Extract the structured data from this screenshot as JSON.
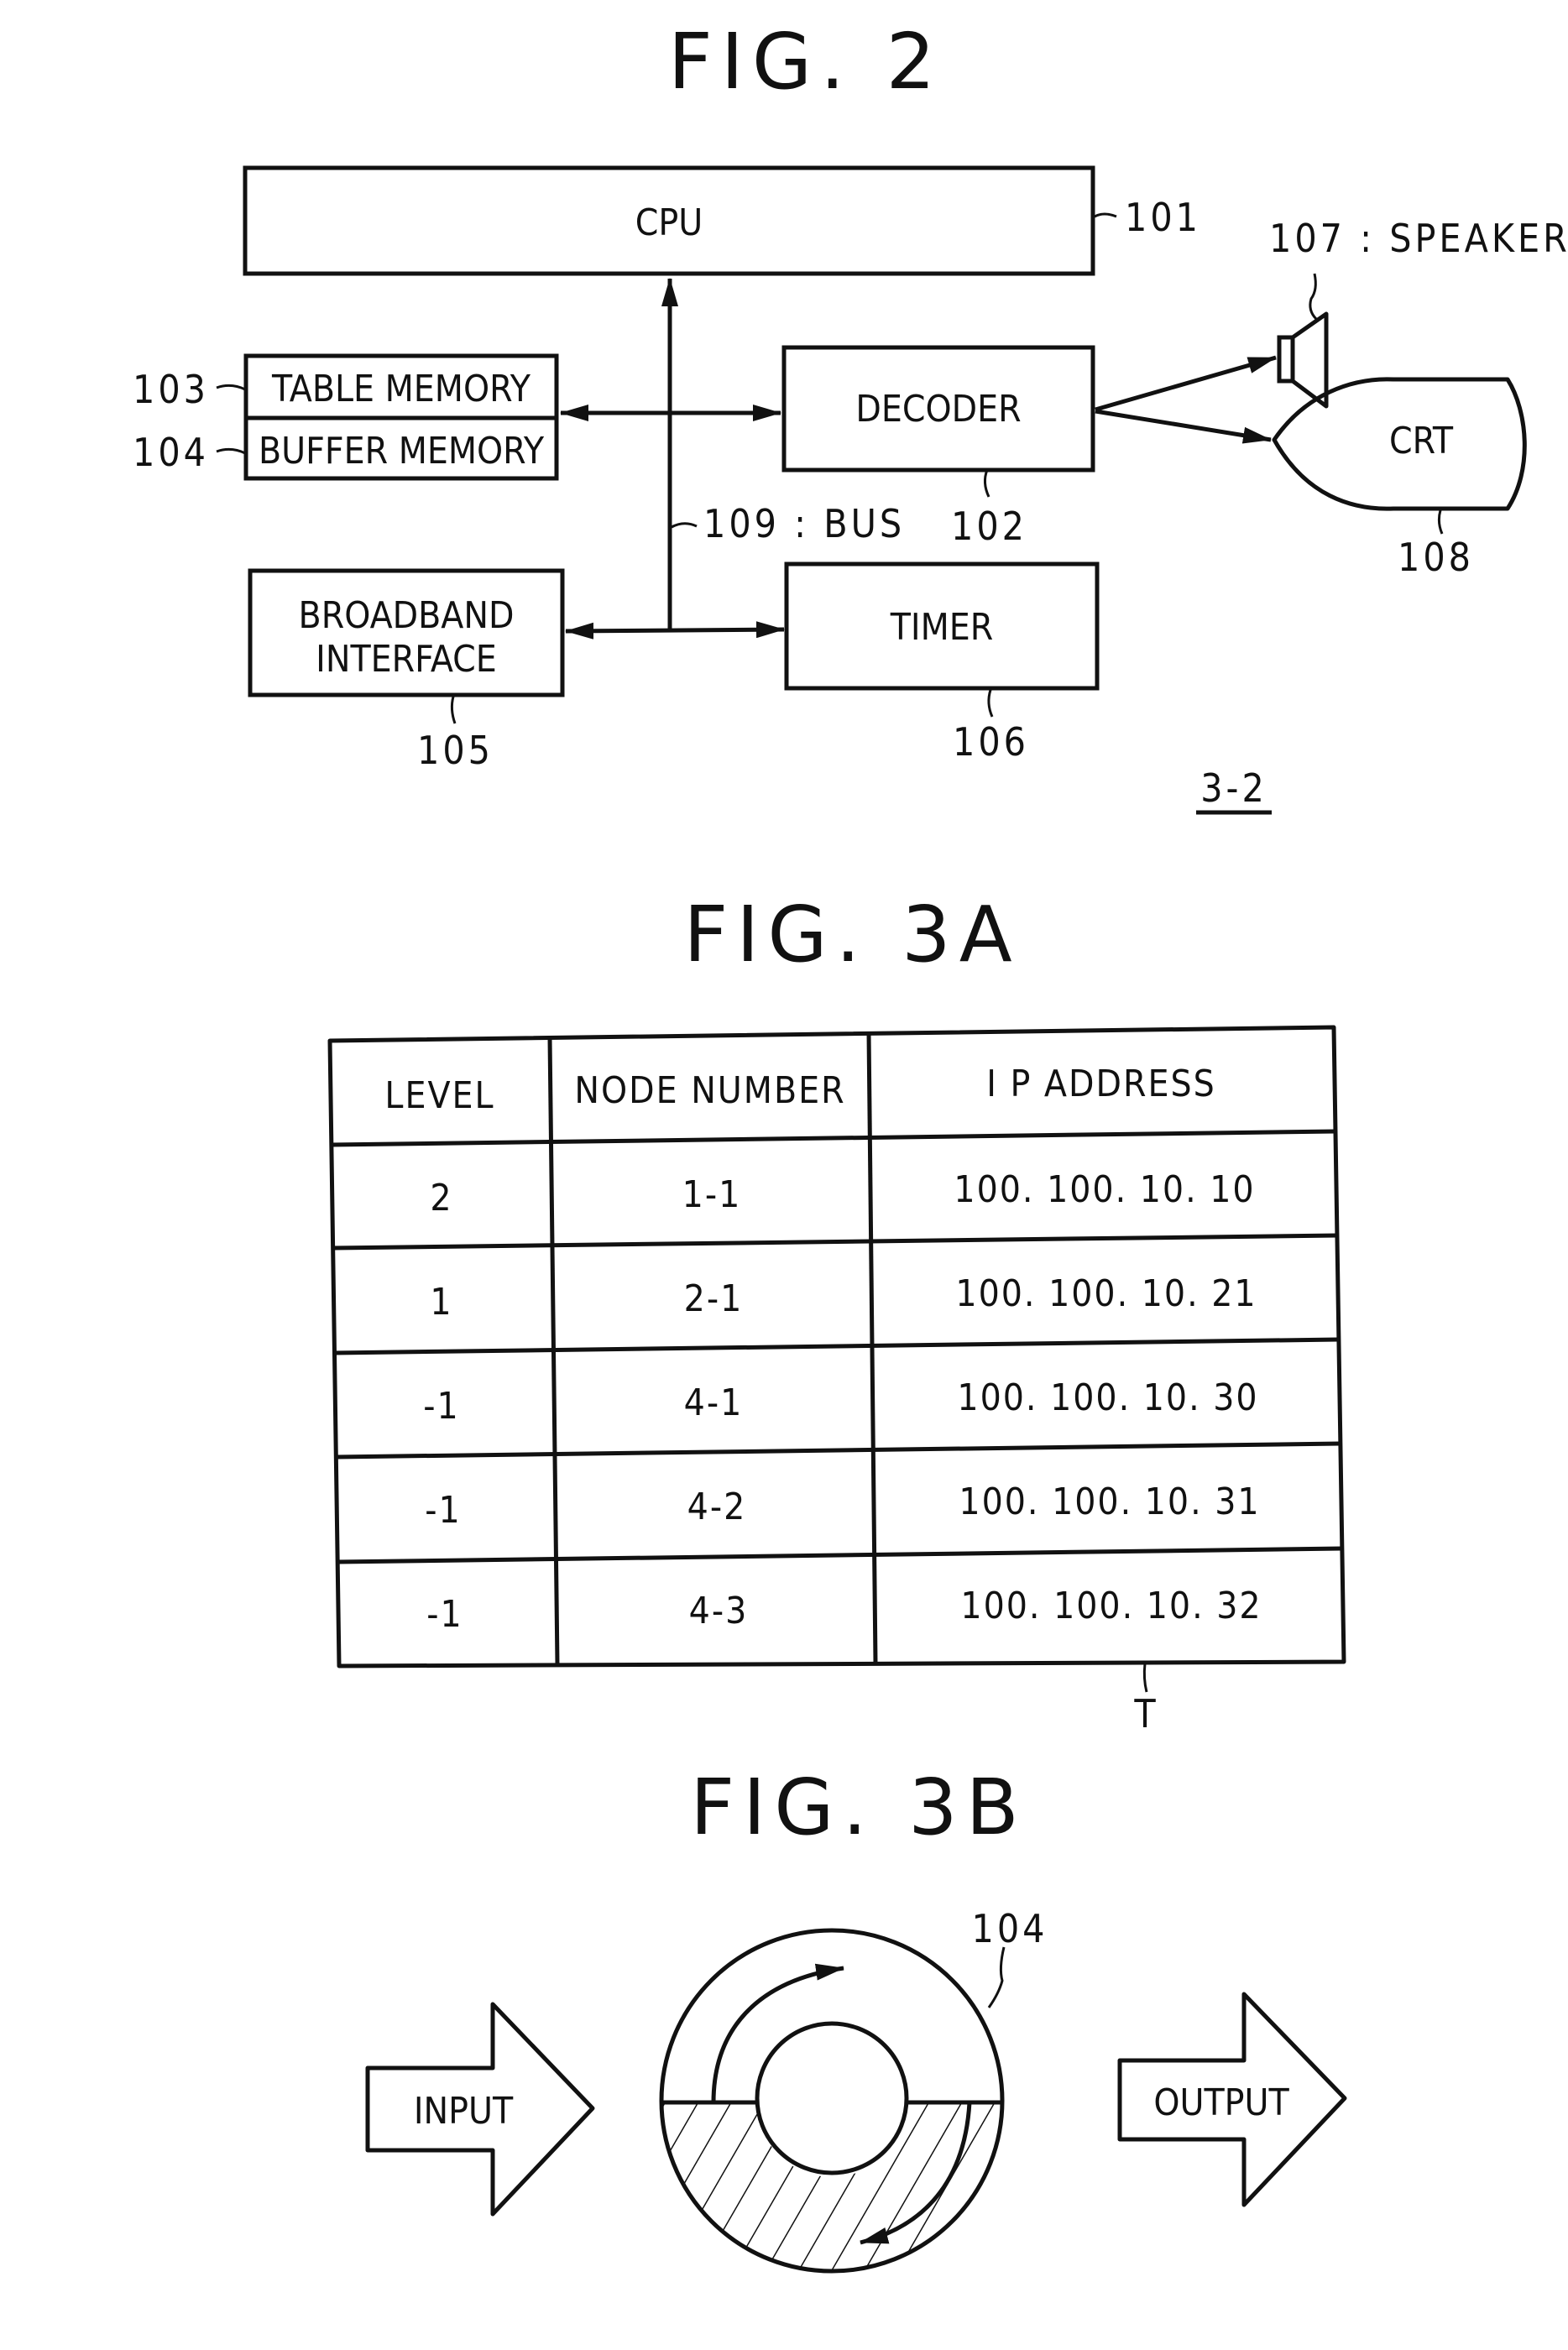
{
  "fig2": {
    "title": "FIG. 2",
    "cpu": {
      "label": "CPU",
      "ref": "101"
    },
    "table_memory": {
      "label": "TABLE MEMORY",
      "ref": "103"
    },
    "buffer_memory": {
      "label": "BUFFER MEMORY",
      "ref": "104"
    },
    "decoder": {
      "label": "DECODER",
      "ref": "102"
    },
    "bus": {
      "label": "109 : BUS"
    },
    "broadband": {
      "line1": "BROADBAND",
      "line2": "INTERFACE",
      "ref": "105"
    },
    "timer": {
      "label": "TIMER",
      "ref": "106"
    },
    "speaker": {
      "label": "107 : SPEAKER"
    },
    "crt": {
      "label": "CRT",
      "ref": "108"
    },
    "device_ref": "3-2"
  },
  "fig3a": {
    "title": "FIG. 3A",
    "columns": [
      "LEVEL",
      "NODE NUMBER",
      "I P ADDRESS"
    ],
    "rows": [
      [
        "2",
        "1-1",
        "100. 100. 10. 10"
      ],
      [
        "1",
        "2-1",
        "100. 100. 10. 21"
      ],
      [
        "-1",
        "4-1",
        "100. 100. 10. 30"
      ],
      [
        "-1",
        "4-2",
        "100. 100. 10. 31"
      ],
      [
        "-1",
        "4-3",
        "100. 100. 10. 32"
      ]
    ],
    "ref": "T"
  },
  "fig3b": {
    "title": "FIG. 3B",
    "input_label": "INPUT",
    "output_label": "OUTPUT",
    "ring_ref": "104"
  }
}
